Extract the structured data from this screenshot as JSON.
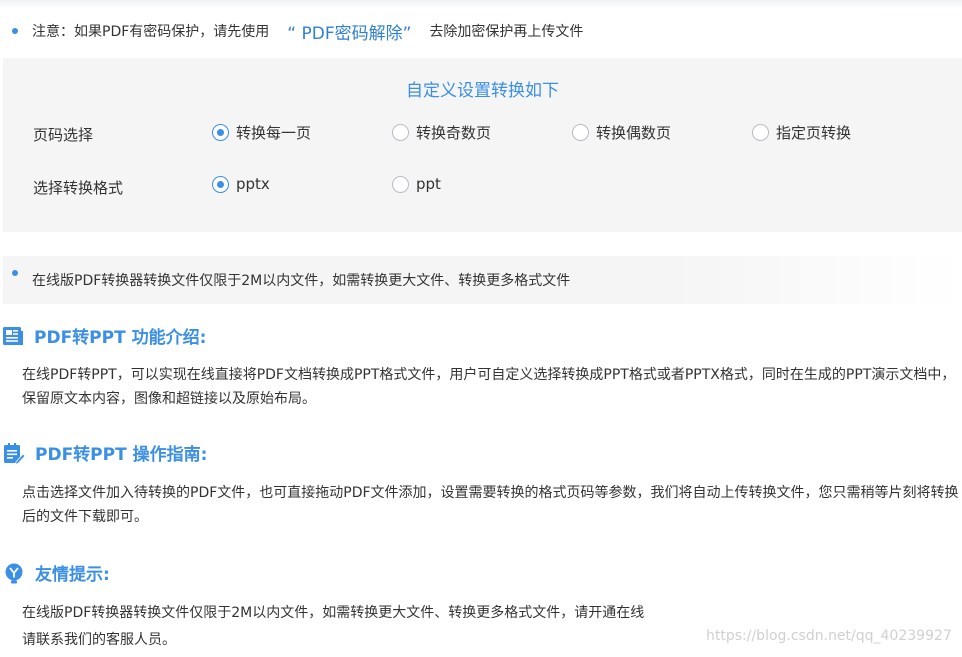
{
  "notice": {
    "prefix": "注意：如果PDF有密码保护，请先使用",
    "link": "“ PDF密码解除”",
    "suffix": "去除加密保护再上传文件"
  },
  "settings": {
    "title": "自定义设置转换如下",
    "page_select": {
      "label": "页码选择",
      "options": [
        "转换每一页",
        "转换奇数页",
        "转换偶数页",
        "指定页转换"
      ],
      "selected": "转换每一页"
    },
    "format_select": {
      "label": "选择转换格式",
      "options": [
        "pptx",
        "ppt"
      ],
      "selected": "pptx"
    }
  },
  "limit_note": "在线版PDF转换器转换文件仅限于2M以内文件，如需转换更大文件、转换更多格式文件",
  "sections": {
    "intro": {
      "title": "PDF转PPT 功能介绍:",
      "body": "在线PDF转PPT，可以实现在线直接将PDF文档转换成PPT格式文件，用户可自定义选择转换成PPT格式或者PPTX格式，同时在生成的PPT演示文档中，保留原文本内容，图像和超链接以及原始布局。"
    },
    "guide": {
      "title": "PDF转PPT 操作指南:",
      "body": "点击选择文件加入待转换的PDF文件，也可直接拖动PDF文件添加，设置需要转换的格式页码等参数，我们将自动上传转换文件，您只需稍等片刻将转换后的文件下载即可。"
    },
    "tips": {
      "title": "友情提示:",
      "line1": "在线版PDF转换器转换文件仅限于2M以内文件，如需转换更大文件、转换更多格式文件，请开通在线",
      "line2": "请联系我们的客服人员。"
    }
  },
  "watermark": "https://blog.csdn.net/qq_40239927",
  "colors": {
    "accent": "#3b8fe4",
    "panel_bg": "#f5f5f6",
    "text": "#333333"
  },
  "icons": [
    "intro-doc-icon",
    "guide-checklist-icon",
    "tips-bulb-icon"
  ]
}
